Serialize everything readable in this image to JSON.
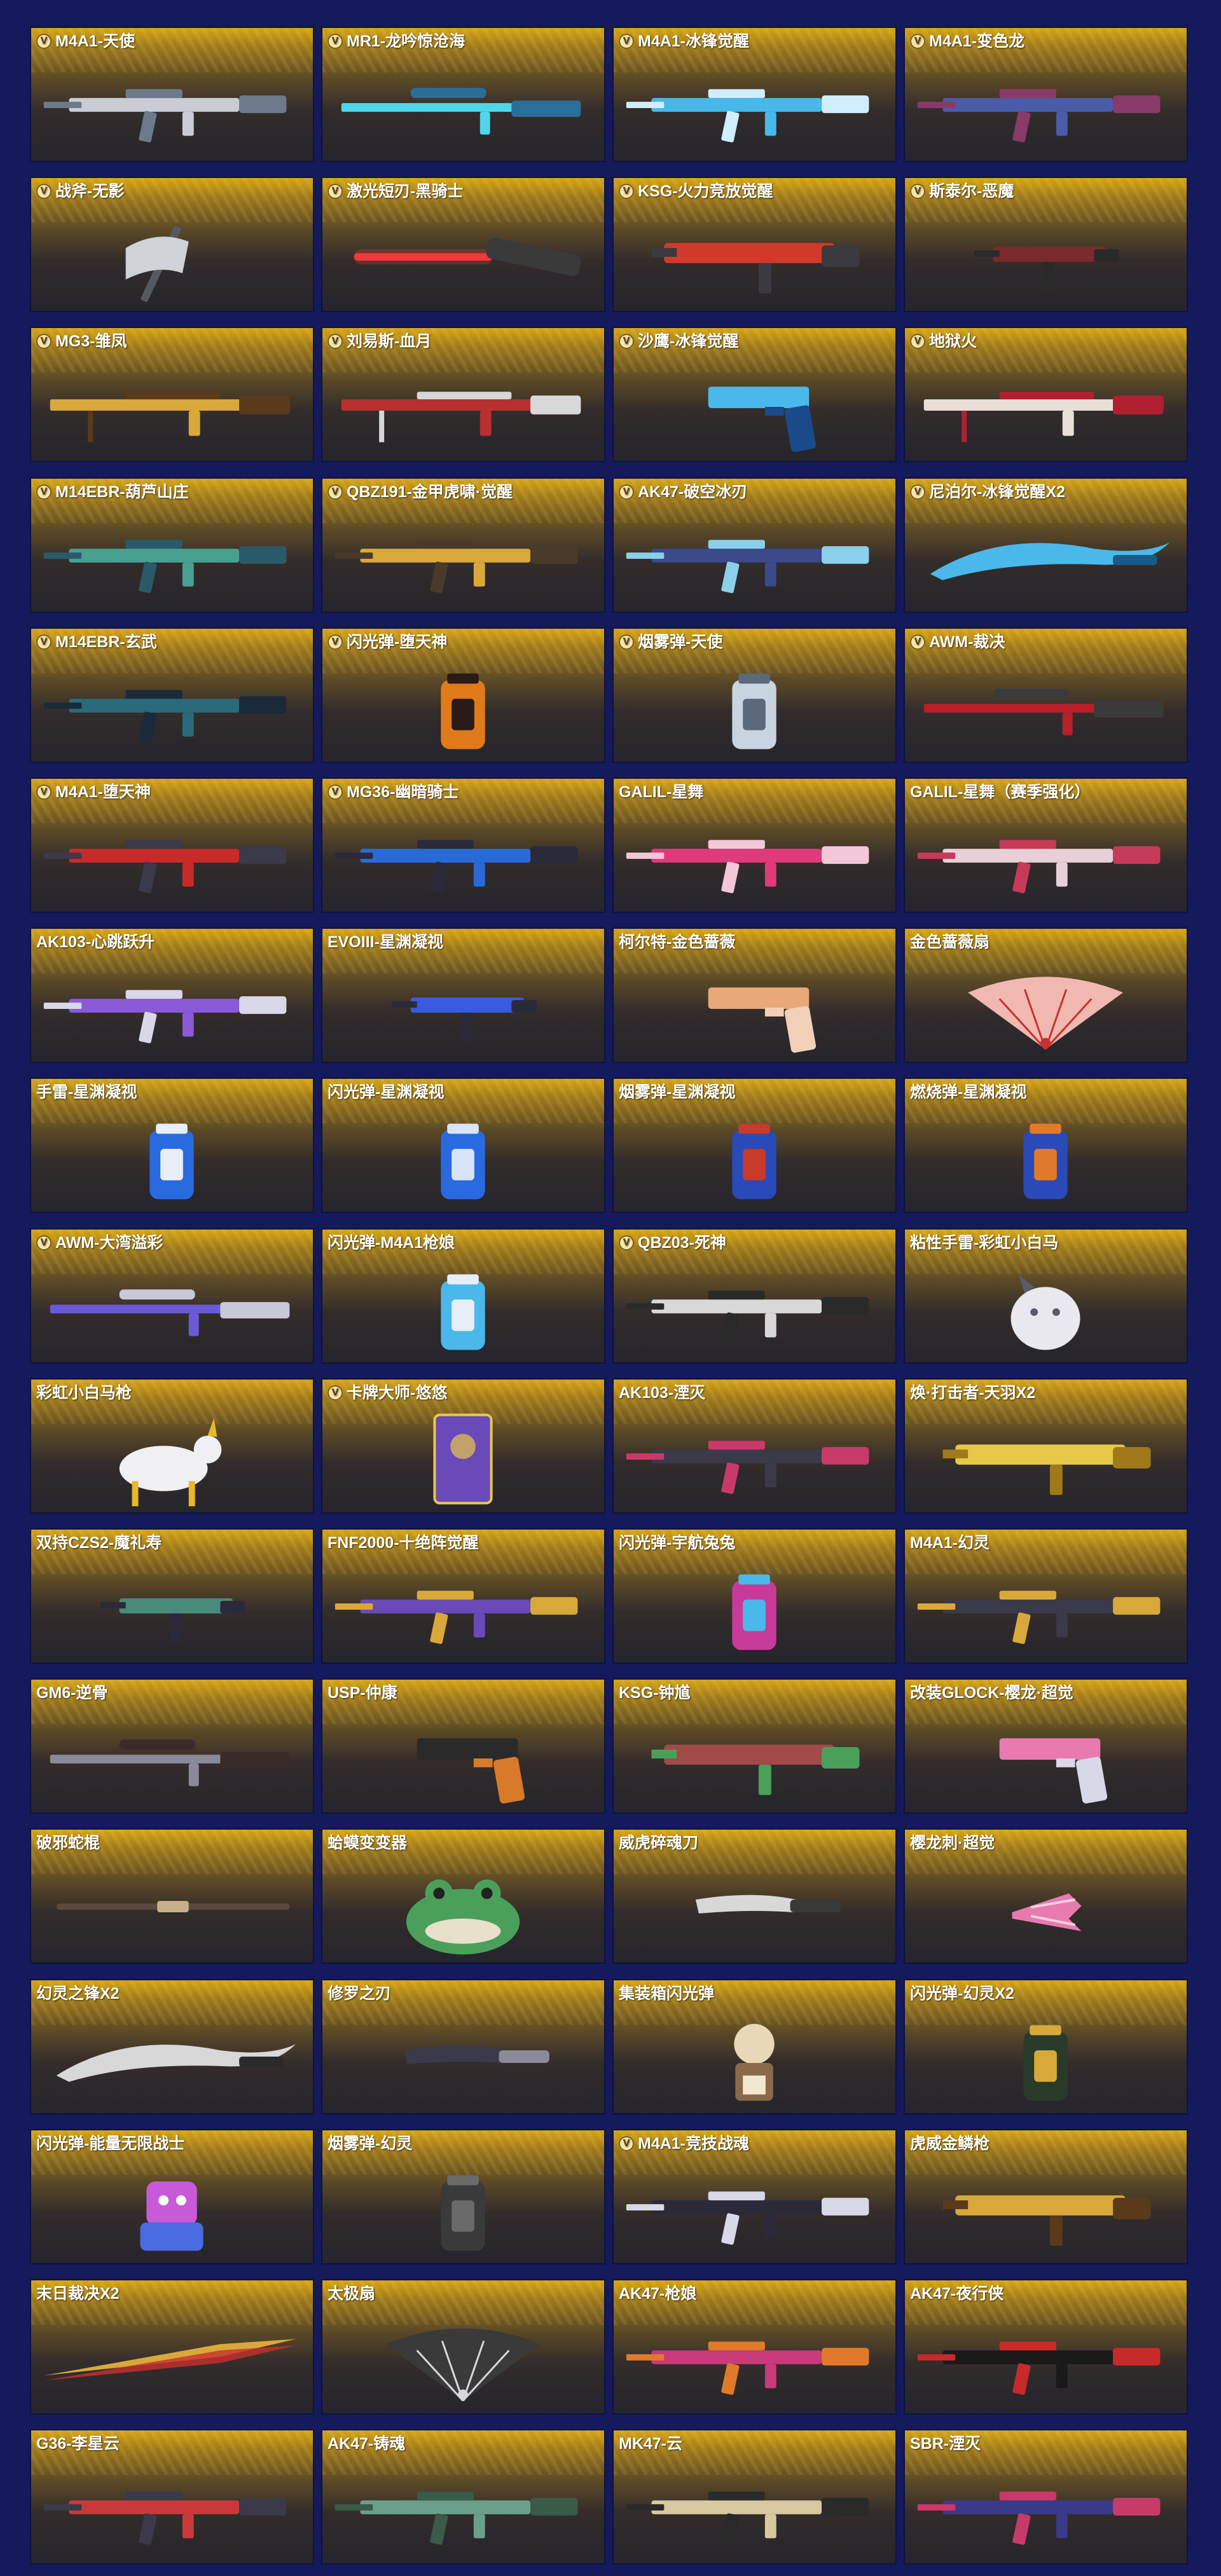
{
  "items": [
    {
      "name": "M4A1-天使",
      "v": true,
      "kind": "rifle",
      "c1": "#c9ccd4",
      "c2": "#6d7a8c"
    },
    {
      "name": "MR1-龙吟惊沧海",
      "v": true,
      "kind": "sniper",
      "c1": "#4fd6e8",
      "c2": "#2a6f9a"
    },
    {
      "name": "M4A1-冰锋觉醒",
      "v": true,
      "kind": "rifle",
      "c1": "#47b8ea",
      "c2": "#cfeeff"
    },
    {
      "name": "M4A1-变色龙",
      "v": true,
      "kind": "rifle",
      "c1": "#4a5ca8",
      "c2": "#8a3a6a"
    },
    {
      "name": "战斧-无影",
      "v": true,
      "kind": "axe",
      "c1": "#cfd3d8",
      "c2": "#555a62"
    },
    {
      "name": "激光短刃-黑骑士",
      "v": true,
      "kind": "laser",
      "c1": "#ff3a3a",
      "c2": "#3a3a3a"
    },
    {
      "name": "KSG-火力竞放觉醒",
      "v": true,
      "kind": "shotgun",
      "c1": "#d13a2a",
      "c2": "#3a3a40"
    },
    {
      "name": "斯泰尔-恶魔",
      "v": true,
      "kind": "smg",
      "c1": "#7a2a2a",
      "c2": "#2a2a2a"
    },
    {
      "name": "MG3-雏凤",
      "v": true,
      "kind": "mg",
      "c1": "#d8a93a",
      "c2": "#5a3a1a"
    },
    {
      "name": "刘易斯-血月",
      "v": true,
      "kind": "mg",
      "c1": "#b83030",
      "c2": "#d8d8d8"
    },
    {
      "name": "沙鹰-冰锋觉醒",
      "v": true,
      "kind": "pistol",
      "c1": "#4ab8ea",
      "c2": "#1a4a8a"
    },
    {
      "name": "地狱火",
      "v": true,
      "kind": "mg",
      "c1": "#e8e0d8",
      "c2": "#b02030"
    },
    {
      "name": "M14EBR-葫芦山庄",
      "v": true,
      "kind": "rifle",
      "c1": "#4aa090",
      "c2": "#2a5a6a"
    },
    {
      "name": "QBZ191-金甲虎啸·觉醒",
      "v": true,
      "kind": "rifle",
      "c1": "#d8a93a",
      "c2": "#4a3a2a"
    },
    {
      "name": "AK47-破空冰刃",
      "v": true,
      "kind": "rifle",
      "c1": "#3a4a8a",
      "c2": "#8ad0ea"
    },
    {
      "name": "尼泊尔-冰锋觉醒X2",
      "v": true,
      "kind": "blade",
      "c1": "#4ab8ea",
      "c2": "#1a5a8a"
    },
    {
      "name": "M14EBR-玄武",
      "v": true,
      "kind": "rifle",
      "c1": "#2a6a7a",
      "c2": "#1a2a3a"
    },
    {
      "name": "闪光弹-堕天神",
      "v": true,
      "kind": "grenade",
      "c1": "#e07a1a",
      "c2": "#2a1a1a"
    },
    {
      "name": "烟雾弹-天使",
      "v": true,
      "kind": "grenade",
      "c1": "#c8d4e0",
      "c2": "#5a6a7a"
    },
    {
      "name": "AWM-裁决",
      "v": true,
      "kind": "sniper",
      "c1": "#b8202a",
      "c2": "#3a3a3a"
    },
    {
      "name": "M4A1-堕天神",
      "v": true,
      "kind": "rifle",
      "c1": "#c82a2a",
      "c2": "#3a3a4a"
    },
    {
      "name": "MG36-幽暗骑士",
      "v": true,
      "kind": "rifle",
      "c1": "#2a6ad8",
      "c2": "#2a2a3a"
    },
    {
      "name": "GALIL-星舞",
      "v": false,
      "kind": "rifle",
      "c1": "#e03a7a",
      "c2": "#f2c8d8"
    },
    {
      "name": "GALIL-星舞（赛季强化）",
      "v": false,
      "kind": "rifle",
      "c1": "#e8d0d8",
      "c2": "#c83a5a"
    },
    {
      "name": "AK103-心跳跃升",
      "v": false,
      "kind": "rifle",
      "c1": "#8a5ad8",
      "c2": "#d8d8e8"
    },
    {
      "name": "EVOIII-星渊凝视",
      "v": false,
      "kind": "smg",
      "c1": "#3a5ae0",
      "c2": "#2a2a3a"
    },
    {
      "name": "柯尔特-金色蔷薇",
      "v": false,
      "kind": "pistol",
      "c1": "#e8a878",
      "c2": "#f2d0b8"
    },
    {
      "name": "金色蔷薇扇",
      "v": false,
      "kind": "fan",
      "c1": "#f0b8b0",
      "c2": "#c83030"
    },
    {
      "name": "手雷-星渊凝视",
      "v": false,
      "kind": "grenade",
      "c1": "#2a6ae0",
      "c2": "#e8eef8"
    },
    {
      "name": "闪光弹-星渊凝视",
      "v": false,
      "kind": "grenade",
      "c1": "#2a6ae0",
      "c2": "#d8e4f8"
    },
    {
      "name": "烟雾弹-星渊凝视",
      "v": false,
      "kind": "grenade",
      "c1": "#2a4ab8",
      "c2": "#c83a2a"
    },
    {
      "name": "燃烧弹-星渊凝视",
      "v": false,
      "kind": "grenade",
      "c1": "#2a4ab8",
      "c2": "#e07a2a"
    },
    {
      "name": "AWM-大湾溢彩",
      "v": true,
      "kind": "sniper",
      "c1": "#6a5ad8",
      "c2": "#c8c8d8"
    },
    {
      "name": "闪光弹-M4A1枪娘",
      "v": false,
      "kind": "grenade",
      "c1": "#4ab8ea",
      "c2": "#e8eef8"
    },
    {
      "name": "QBZ03-死神",
      "v": true,
      "kind": "rifle",
      "c1": "#d8d8d8",
      "c2": "#2a2a2a"
    },
    {
      "name": "粘性手雷-彩虹小白马",
      "v": false,
      "kind": "pet",
      "c1": "#e8e8ee",
      "c2": "#5a5a6a"
    },
    {
      "name": "彩虹小白马枪",
      "v": false,
      "kind": "pony",
      "c1": "#f0f0f4",
      "c2": "#e8b82a"
    },
    {
      "name": "卡牌大师-悠悠",
      "v": true,
      "kind": "card",
      "c1": "#6a4ab8",
      "c2": "#e8c84a"
    },
    {
      "name": "AK103-湮灭",
      "v": false,
      "kind": "rifle",
      "c1": "#3a3a4a",
      "c2": "#c83a6a"
    },
    {
      "name": "焕·打击者-天羽X2",
      "v": false,
      "kind": "shotgun",
      "c1": "#e8c84a",
      "c2": "#a07a1a"
    },
    {
      "name": "双持CZS2-魔礼寿",
      "v": false,
      "kind": "smg",
      "c1": "#4a8a7a",
      "c2": "#2a2a3a"
    },
    {
      "name": "FNF2000-十绝阵觉醒",
      "v": false,
      "kind": "rifle",
      "c1": "#6a4ab8",
      "c2": "#d8a93a"
    },
    {
      "name": "闪光弹-宇航兔兔",
      "v": false,
      "kind": "grenade",
      "c1": "#c83a9a",
      "c2": "#4ab8ea"
    },
    {
      "name": "M4A1-幻灵",
      "v": false,
      "kind": "rifle",
      "c1": "#3a3a4a",
      "c2": "#d8a93a"
    },
    {
      "name": "GM6-逆骨",
      "v": false,
      "kind": "sniper",
      "c1": "#8a8a9a",
      "c2": "#3a2a2a"
    },
    {
      "name": "USP-仲康",
      "v": false,
      "kind": "pistol",
      "c1": "#2a2a2a",
      "c2": "#d87a2a"
    },
    {
      "name": "KSG-钟馗",
      "v": false,
      "kind": "shotgun",
      "c1": "#a04a4a",
      "c2": "#4aa05a"
    },
    {
      "name": "改装GLOCK-樱龙·超觉",
      "v": false,
      "kind": "pistol",
      "c1": "#e87ab0",
      "c2": "#d8d8e8"
    },
    {
      "name": "破邪蛇棍",
      "v": false,
      "kind": "staff",
      "c1": "#5a4a3a",
      "c2": "#c8b08a"
    },
    {
      "name": "蛤蟆变变器",
      "v": false,
      "kind": "frog",
      "c1": "#4aa05a",
      "c2": "#e8e0c8"
    },
    {
      "name": "威虎碎魂刀",
      "v": false,
      "kind": "knife",
      "c1": "#d8d8d8",
      "c2": "#3a3a3a"
    },
    {
      "name": "樱龙刺·超觉",
      "v": false,
      "kind": "claw",
      "c1": "#e87ab0",
      "c2": "#f2d0e0"
    },
    {
      "name": "幻灵之锋X2",
      "v": false,
      "kind": "blade",
      "c1": "#d8d8d8",
      "c2": "#2a2a2a"
    },
    {
      "name": "修罗之刃",
      "v": false,
      "kind": "knife",
      "c1": "#3a3a4a",
      "c2": "#8a8a9a"
    },
    {
      "name": "集装箱闪光弹",
      "v": false,
      "kind": "doll",
      "c1": "#8a6a4a",
      "c2": "#e8d8b8"
    },
    {
      "name": "闪光弹-幻灵X2",
      "v": false,
      "kind": "grenade",
      "c1": "#2a3a2a",
      "c2": "#d8a93a"
    },
    {
      "name": "闪光弹-能量无限战士",
      "v": false,
      "kind": "robot",
      "c1": "#c85ad8",
      "c2": "#4a6ae0"
    },
    {
      "name": "烟雾弹-幻灵",
      "v": false,
      "kind": "grenade",
      "c1": "#3a3a3a",
      "c2": "#6a6a6a"
    },
    {
      "name": "M4A1-竞技战魂",
      "v": true,
      "kind": "rifle",
      "c1": "#2a2a3a",
      "c2": "#d8d8e8"
    },
    {
      "name": "虎威金鳞枪",
      "v": false,
      "kind": "shotgun",
      "c1": "#d8a93a",
      "c2": "#5a3a1a"
    },
    {
      "name": "末日裁决X2",
      "v": false,
      "kind": "longblade",
      "c1": "#d8a93a",
      "c2": "#c83030"
    },
    {
      "name": "太极扇",
      "v": false,
      "kind": "fan",
      "c1": "#3a3a3a",
      "c2": "#d8d8d8"
    },
    {
      "name": "AK47-枪娘",
      "v": false,
      "kind": "rifle",
      "c1": "#c83a7a",
      "c2": "#e07a2a"
    },
    {
      "name": "AK47-夜行侠",
      "v": false,
      "kind": "rifle",
      "c1": "#1a1a1a",
      "c2": "#c82a2a"
    },
    {
      "name": "G36-李星云",
      "v": false,
      "kind": "rifle",
      "c1": "#c83a3a",
      "c2": "#3a3a4a"
    },
    {
      "name": "AK47-铸魂",
      "v": false,
      "kind": "rifle",
      "c1": "#6aa08a",
      "c2": "#3a5a4a"
    },
    {
      "name": "MK47-云",
      "v": false,
      "kind": "rifle",
      "c1": "#d8c8a0",
      "c2": "#2a2a2a"
    },
    {
      "name": "SBR-湮灭",
      "v": false,
      "kind": "rifle",
      "c1": "#3a3a8a",
      "c2": "#c83a6a"
    }
  ]
}
